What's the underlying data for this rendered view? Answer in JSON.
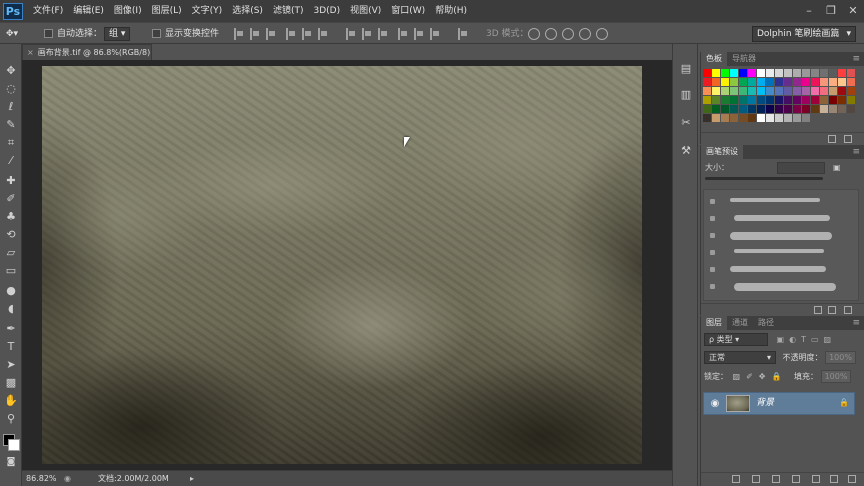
{
  "app": {
    "logo": "Ps"
  },
  "menubar": {
    "items": [
      "文件(F)",
      "编辑(E)",
      "图像(I)",
      "图层(L)",
      "文字(Y)",
      "选择(S)",
      "滤镜(T)",
      "3D(D)",
      "视图(V)",
      "窗口(W)",
      "帮助(H)"
    ],
    "window_controls": [
      "minimize",
      "restore",
      "close"
    ]
  },
  "options_bar": {
    "auto_select_label": "自动选择：",
    "auto_select_checked": false,
    "auto_select_target": "组",
    "show_transform_label": "显示变换控件",
    "show_transform_checked": false,
    "mode_3d_label": "3D 模式：",
    "workspace": "Dolphin 笔刷绘画篇"
  },
  "toolbar": {
    "tools": [
      "move-tool",
      "marquee-tool",
      "lasso-tool",
      "quick-select-tool",
      "crop-tool",
      "eyedropper-tool",
      "healing-brush-tool",
      "brush-tool",
      "clone-stamp-tool",
      "history-brush-tool",
      "eraser-tool",
      "gradient-tool",
      "blur-tool",
      "dodge-tool",
      "pen-tool",
      "type-tool",
      "path-select-tool",
      "shape-tool",
      "hand-tool",
      "zoom-tool"
    ],
    "foreground_color": "#000000",
    "background_color": "#ffffff"
  },
  "document": {
    "tab_title": "画布背景.tif @ 86.8%(RGB/8)",
    "zoom": "86.82%",
    "doc_info": "文档:2.00M/2.00M"
  },
  "panels": {
    "swatches": {
      "tabs": [
        "色板",
        "导航器"
      ],
      "active_tab": "色板",
      "colors": [
        "#ff0000",
        "#ffff00",
        "#00ff00",
        "#00ffff",
        "#0000ff",
        "#ff00ff",
        "#ffffff",
        "#ebebeb",
        "#d6d6d6",
        "#c2c2c2",
        "#adadad",
        "#999999",
        "#858585",
        "#707070",
        "#5c5c5c",
        "#ff3f3f",
        "#e05151",
        "#ed1c24",
        "#f26522",
        "#fff200",
        "#8dc63f",
        "#00a651",
        "#00a99d",
        "#00aeef",
        "#0072bc",
        "#2e3192",
        "#662d91",
        "#92278f",
        "#ec008c",
        "#ed145b",
        "#f7977a",
        "#fbad82",
        "#fdc68c",
        "#f26c4f",
        "#f68e55",
        "#fff468",
        "#acd373",
        "#7cc576",
        "#3bb878",
        "#1abbb4",
        "#00bff3",
        "#438ccb",
        "#5574b9",
        "#605ca8",
        "#855fa8",
        "#a763a8",
        "#f06ea9",
        "#f26d7d",
        "#c69c6d",
        "#9e0b0f",
        "#a0410d",
        "#aba000",
        "#598527",
        "#1a7b30",
        "#007236",
        "#00746b",
        "#0076a3",
        "#004b80",
        "#003471",
        "#1b1464",
        "#440e62",
        "#630460",
        "#9e005d",
        "#9e0039",
        "#8c6239",
        "#790000",
        "#7b2e00",
        "#827b00",
        "#406618",
        "#005e20",
        "#005826",
        "#005952",
        "#005b7f",
        "#003663",
        "#002157",
        "#0d004c",
        "#32004b",
        "#4b0049",
        "#7b0046",
        "#7a0026",
        "#603913",
        "#c7b299",
        "#998675",
        "#736357",
        "#534741",
        "#37302a",
        "#c69c6d",
        "#a67c52",
        "#8c6239",
        "#754c24",
        "#603913",
        "#ffffff",
        "#e6e6e6",
        "#cccccc",
        "#b3b3b3",
        "#999999",
        "#808080"
      ]
    },
    "brush": {
      "tabs": [
        "画笔预设"
      ],
      "size_label": "大小：",
      "stroke_count": 6
    },
    "layers": {
      "tabs": [
        "图层",
        "通道",
        "路径"
      ],
      "active_tab": "图层",
      "filter_label": "ρ 类型",
      "blend_mode": "正常",
      "opacity_label": "不透明度：",
      "opacity_value": "100%",
      "lock_label": "锁定：",
      "fill_label": "填充：",
      "fill_value": "100%",
      "layer_name": "背景",
      "layer_visible": true,
      "layer_locked": true
    }
  }
}
